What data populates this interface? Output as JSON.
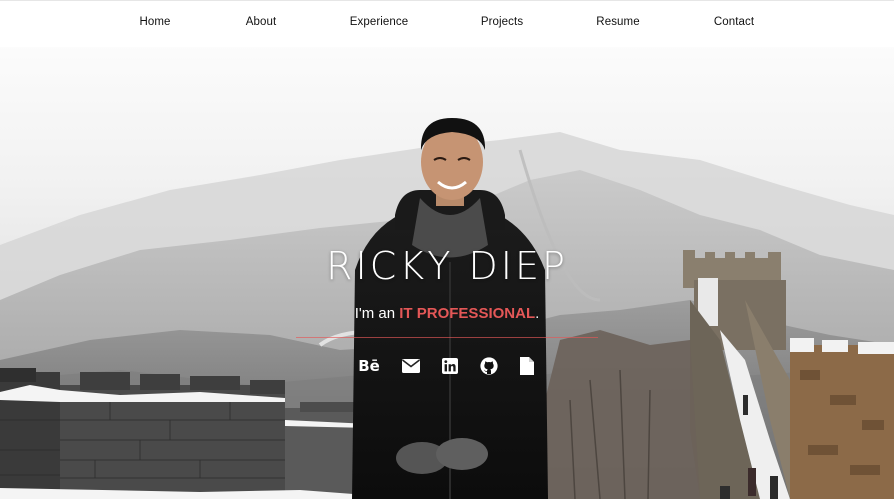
{
  "nav": {
    "items": [
      {
        "label": "Home"
      },
      {
        "label": "About"
      },
      {
        "label": "Experience"
      },
      {
        "label": "Projects"
      },
      {
        "label": "Resume"
      },
      {
        "label": "Contact"
      }
    ]
  },
  "hero": {
    "name": "RICKY DIEP",
    "tagline_prefix": "I'm an ",
    "tagline_highlight": "IT PROFESSIONAL",
    "tagline_suffix": ".",
    "accent_color": "#e45757",
    "background_description_icon": "great-wall-photo"
  },
  "socials": {
    "behance_label": "Bē",
    "items": [
      {
        "icon": "behance-icon"
      },
      {
        "icon": "envelope-icon"
      },
      {
        "icon": "linkedin-icon"
      },
      {
        "icon": "github-icon"
      },
      {
        "icon": "document-icon"
      }
    ]
  },
  "colors": {
    "nav_text": "#111111",
    "hero_text": "#ffffff",
    "accent": "#e45757"
  }
}
